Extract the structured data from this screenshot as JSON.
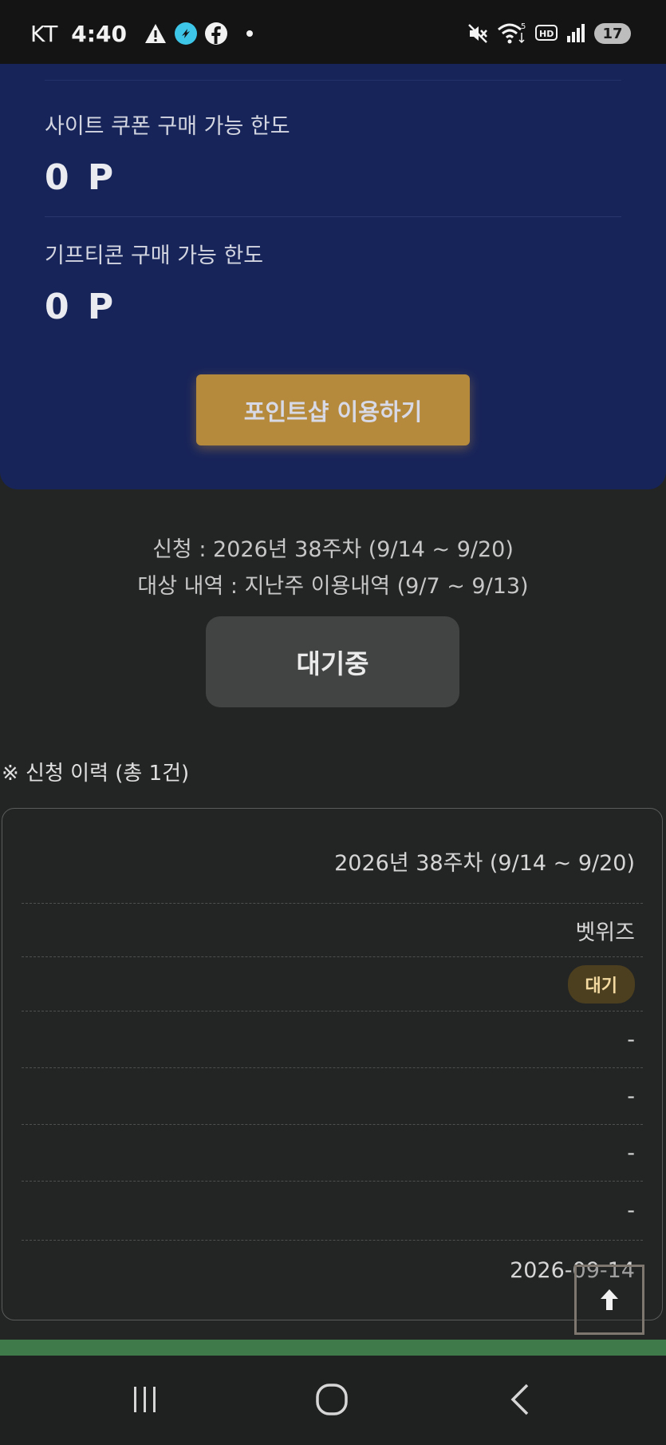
{
  "status_bar": {
    "carrier": "KT",
    "time": "4:40",
    "battery": "17",
    "left_icons": [
      "warning-icon",
      "app-icon",
      "facebook-icon",
      "dot-icon"
    ],
    "right_icons": [
      "mute-icon",
      "wifi-icon",
      "hd-icon",
      "signal-icon",
      "battery-icon"
    ]
  },
  "points": {
    "site_coupon_label": "사이트 쿠폰 구매 가능 한도",
    "site_coupon_value": "0 P",
    "gifticon_label": "기프티콘 구매 가능 한도",
    "gifticon_value": "0 P",
    "shop_button": "포인트샵 이용하기"
  },
  "apply": {
    "period_line": "신청 : 2026년 38주차 (9/14 ~ 9/20)",
    "target_line": "대상 내역 : 지난주 이용내역 (9/7 ~ 9/13)",
    "status_button": "대기중"
  },
  "history": {
    "title": "※ 신청 이력 (총 1건)",
    "week": "2026년 38주차 (9/14 ~ 9/20)",
    "site": "벳위즈",
    "status": "대기",
    "field_4": "-",
    "field_5": "-",
    "field_6": "-",
    "field_7": "-",
    "date": "2026-09-14"
  },
  "colors": {
    "card_navy": "#17245a",
    "shop_button": "#b68a3c",
    "badge_bg": "#4b3f1f",
    "green_bar": "#3f7a4b"
  }
}
